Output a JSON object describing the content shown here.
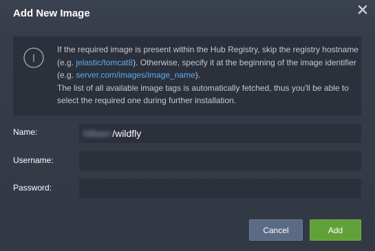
{
  "dialog": {
    "title": "Add New Image",
    "close_icon": "close-icon"
  },
  "info": {
    "icon": "info-icon",
    "line1_a": "If the required image is present within the Hub Registry, skip the registry hostname (e.g. ",
    "link1": "jelastic/tomcat8",
    "line1_b": "). Otherwise, specify it at the beginning of the image identifier (e.g. ",
    "link2": "server.com/images/image_name",
    "line1_c": ").",
    "line2": "The list of all available image tags is automatically fetched, thus you'll be able to select the required one during further installation."
  },
  "form": {
    "name_label": "Name:",
    "name_prefix_blurred": "hiltserı",
    "name_value": "/wildfly",
    "username_label": "Username:",
    "username_value": "",
    "password_label": "Password:",
    "password_value": ""
  },
  "buttons": {
    "cancel_label": "Cancel",
    "add_label": "Add"
  },
  "colors": {
    "background": "#363c49",
    "panel": "#2b303b",
    "link": "#5aaef0",
    "cancel": "#5c6b84",
    "add": "#61a039"
  }
}
